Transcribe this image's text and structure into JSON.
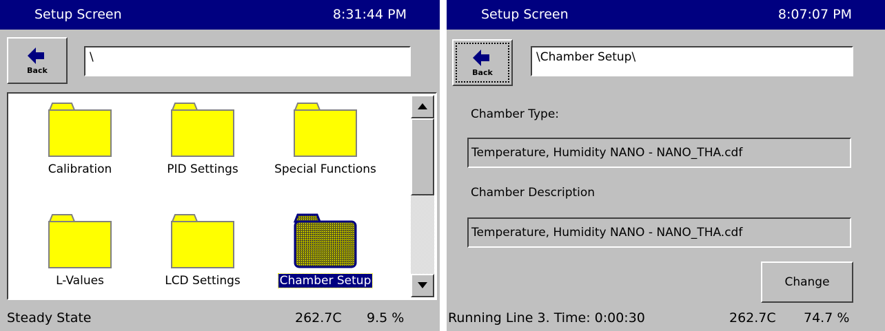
{
  "left": {
    "title": "Setup Screen",
    "time": "8:31:44 PM",
    "back_label": "Back",
    "path": "\\",
    "folders": [
      {
        "label": "Calibration",
        "icon": "folder-icon"
      },
      {
        "label": "PID Settings",
        "icon": "folder-icon"
      },
      {
        "label": "Special Functions",
        "icon": "folder-icon"
      },
      {
        "label": "L-Values",
        "icon": "folder-icon"
      },
      {
        "label": "LCD Settings",
        "icon": "folder-icon"
      },
      {
        "label": "Chamber Setup",
        "icon": "folder-icon",
        "selected": true
      }
    ],
    "status": {
      "state": "Steady State",
      "temperature": "262.7C",
      "humidity": "9.5 %"
    }
  },
  "right": {
    "title": "Setup Screen",
    "time": "8:07:07 PM",
    "back_label": "Back",
    "path": "\\Chamber Setup\\",
    "chamber_type_label": "Chamber Type:",
    "chamber_type_value": "Temperature, Humidity NANO - NANO_THA.cdf",
    "chamber_description_label": "Chamber Description",
    "chamber_description_value": "Temperature, Humidity NANO - NANO_THA.cdf",
    "change_label": "Change",
    "status": {
      "state": "Running Line 3.  Time: 0:00:30",
      "temperature": "262.7C",
      "humidity": "74.7 %"
    }
  },
  "colors": {
    "titlebar": "#000080",
    "panel": "#c0c0c0",
    "folder": "#ffff00",
    "selection": "#000080"
  }
}
